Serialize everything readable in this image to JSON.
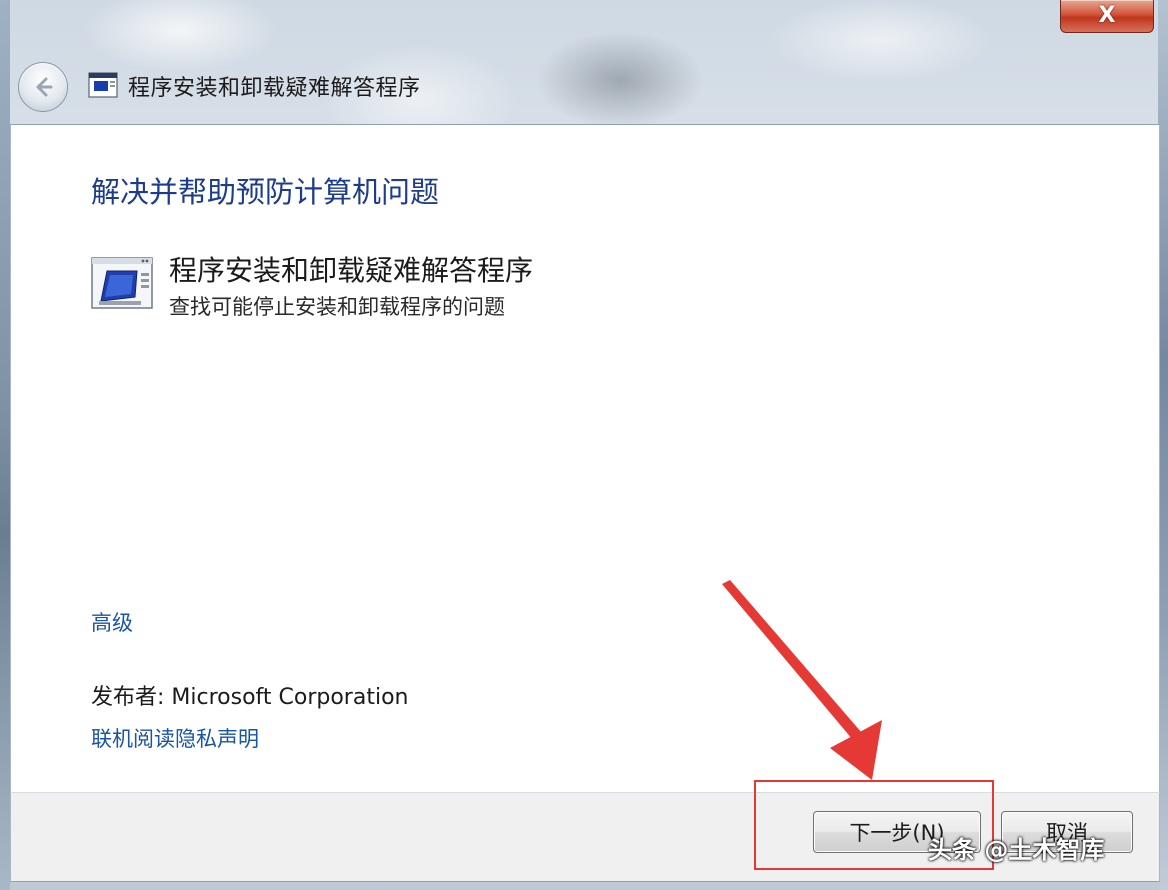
{
  "window": {
    "title": "程序安装和卸载疑难解答程序",
    "close_symbol": "X"
  },
  "content": {
    "heading": "解决并帮助预防计算机问题",
    "troubleshooter": {
      "title": "程序安装和卸载疑难解答程序",
      "description": "查找可能停止安装和卸载程序的问题",
      "icon": "troubleshooter-computer-icon"
    },
    "advanced_link": "高级",
    "publisher": "发布者: Microsoft Corporation",
    "privacy_link": "联机阅读隐私声明"
  },
  "footer": {
    "next_label": "下一步(N)",
    "cancel_label": "取消"
  },
  "annotation": {
    "color": "#e53935"
  },
  "watermark": "头条 @土木智库"
}
